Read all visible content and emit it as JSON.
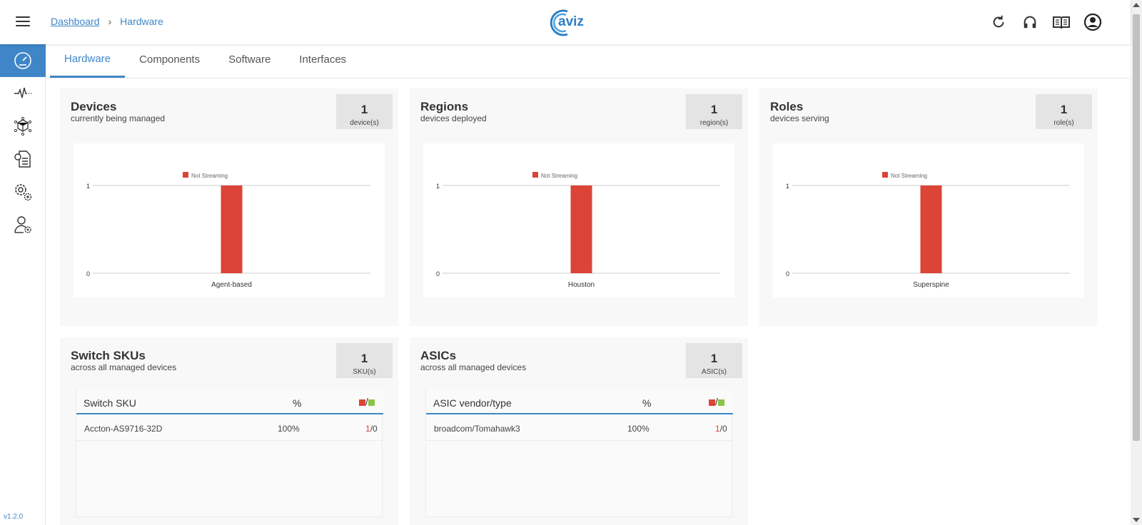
{
  "breadcrumb": {
    "root": "Dashboard",
    "current": "Hardware"
  },
  "brand": {
    "name": "aviz",
    "accent": "#3f86c8"
  },
  "top_icons": [
    "refresh-icon",
    "headset-icon",
    "book-icon",
    "user-account-icon"
  ],
  "sidebar": {
    "items": [
      "dashboard-gauge-icon",
      "pulse-monitor-icon",
      "network-cube-icon",
      "config-document-icon",
      "settings-gears-icon",
      "user-settings-icon"
    ],
    "active": 0
  },
  "version": "v1.2.0",
  "tabs": [
    {
      "label": "Hardware",
      "active": true
    },
    {
      "label": "Components",
      "active": false
    },
    {
      "label": "Software",
      "active": false
    },
    {
      "label": "Interfaces",
      "active": false
    }
  ],
  "cards": {
    "devices": {
      "title": "Devices",
      "subtitle": "currently being managed",
      "count": "1",
      "unit": "device(s)"
    },
    "regions": {
      "title": "Regions",
      "subtitle": "devices deployed",
      "count": "1",
      "unit": "region(s)"
    },
    "roles": {
      "title": "Roles",
      "subtitle": "devices serving",
      "count": "1",
      "unit": "role(s)"
    },
    "skus": {
      "title": "Switch SKUs",
      "subtitle": "across all managed devices",
      "count": "1",
      "unit": "SKU(s)"
    },
    "asics": {
      "title": "ASICs",
      "subtitle": "across all managed devices",
      "count": "1",
      "unit": "ASIC(s)"
    }
  },
  "colors": {
    "not_streaming": "#db4437",
    "streaming": "#8bc34a"
  },
  "chart_data": [
    {
      "type": "bar",
      "categories": [
        "Agent-based"
      ],
      "series": [
        {
          "name": "Not Streaming",
          "values": [
            1
          ]
        }
      ],
      "ylim": [
        0,
        1
      ],
      "yticks": [
        "1",
        "0"
      ],
      "legend": "top"
    },
    {
      "type": "bar",
      "categories": [
        "Houston"
      ],
      "series": [
        {
          "name": "Not Streaming",
          "values": [
            1
          ]
        }
      ],
      "ylim": [
        0,
        1
      ],
      "yticks": [
        "1",
        "0"
      ],
      "legend": "top"
    },
    {
      "type": "bar",
      "categories": [
        "Superspine"
      ],
      "series": [
        {
          "name": "Not Streaming",
          "values": [
            1
          ]
        }
      ],
      "ylim": [
        0,
        1
      ],
      "yticks": [
        "1",
        "0"
      ],
      "legend": "top"
    }
  ],
  "sku_table": {
    "headers": [
      "Switch SKU",
      "%",
      "/"
    ],
    "rows": [
      {
        "name": "Accton-AS9716-32D",
        "pct": "100%",
        "down": "1",
        "up": "/0"
      }
    ]
  },
  "asic_table": {
    "headers": [
      "ASIC vendor/type",
      "%",
      "/"
    ],
    "rows": [
      {
        "name": "broadcom/Tomahawk3",
        "pct": "100%",
        "down": "1",
        "up": "/0"
      }
    ]
  }
}
